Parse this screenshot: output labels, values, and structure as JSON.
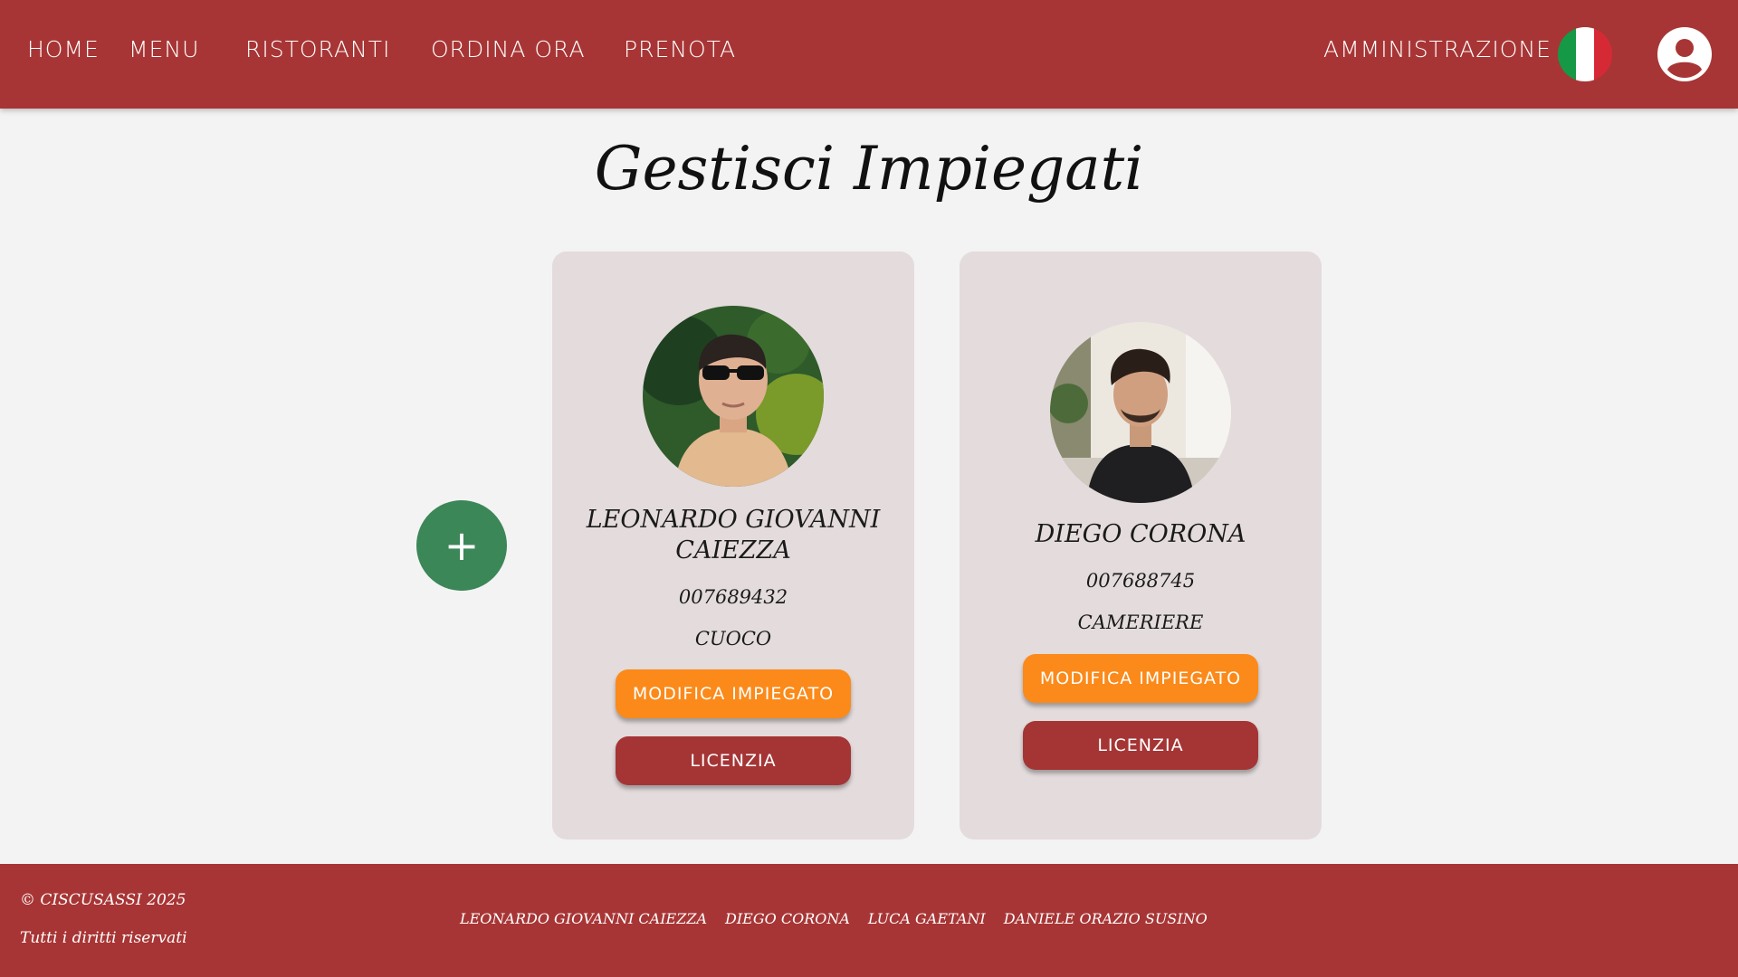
{
  "nav": {
    "items": [
      {
        "id": "home",
        "label": "HOME"
      },
      {
        "id": "menu",
        "label": "MENU"
      },
      {
        "id": "ristoranti",
        "label": "RISTORANTI"
      },
      {
        "id": "ordina",
        "label": "ORDINA ORA"
      },
      {
        "id": "prenota",
        "label": "PRENOTA"
      }
    ],
    "admin_label": "AMMINISTRAZIONE",
    "language_icon": "italian-flag-icon",
    "account_icon": "user-account-icon"
  },
  "page": {
    "title": "Gestisci Impiegati"
  },
  "add_button": {
    "label": "+"
  },
  "employees": [
    {
      "name": "LEONARDO GIOVANNI CAIEZZA",
      "code": "007689432",
      "role": "CUOCO",
      "edit_label": "MODIFICA IMPIEGATO",
      "fire_label": "LICENZIA"
    },
    {
      "name": "DIEGO CORONA",
      "code": "007688745",
      "role": "CAMERIERE",
      "edit_label": "MODIFICA IMPIEGATO",
      "fire_label": "LICENZIA"
    }
  ],
  "footer": {
    "copyright": "© CISCUSASSI 2025",
    "rights": "Tutti i diritti riservati",
    "authors": [
      "LEONARDO GIOVANNI CAIEZZA",
      "DIEGO CORONA",
      "LUCA GAETANI",
      "DANIELE ORAZIO SUSINO"
    ]
  },
  "colors": {
    "brand": "#a83535",
    "edit_button": "#fb8a1a",
    "fire_button": "#a53535",
    "add_button": "#3b8757",
    "card_bg": "#e3dbdc",
    "page_bg": "#f3f3f4"
  }
}
